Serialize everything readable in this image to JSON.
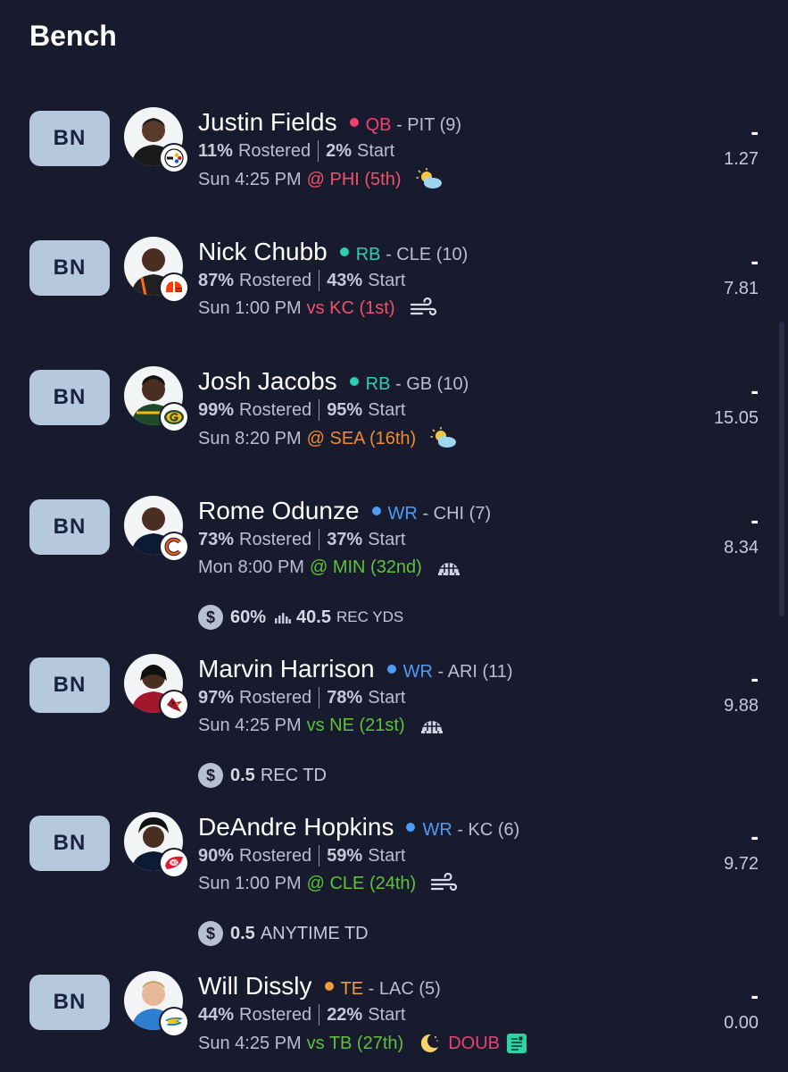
{
  "section_title": "Bench",
  "colors": {
    "qb": "#f0406e",
    "rb": "#2ad0b3",
    "wr": "#4e9bf5",
    "te": "#f39a3a",
    "bad_matchup": "#f0506a",
    "mid_matchup": "#f08a32",
    "good_matchup": "#5dc23a",
    "doub": "#e8446f"
  },
  "players": [
    {
      "slot": "BN",
      "name": "Justin Fields",
      "position": "QB",
      "pos_color": "#f0406e",
      "team": "- PIT (9)",
      "rostered_pct": "11%",
      "rostered_label": "Rostered",
      "start_pct": "2%",
      "start_label": "Start",
      "game_time": "Sun 4:25 PM",
      "opponent": "@ PHI (5th)",
      "opp_color": "#f0506a",
      "weather_icon": "partly-cloudy-icon",
      "team_logo": "steelers-logo",
      "proj_dash": "-",
      "proj_value": "1.27"
    },
    {
      "slot": "BN",
      "name": "Nick Chubb",
      "position": "RB",
      "pos_color": "#2ad0b3",
      "team": "- CLE (10)",
      "rostered_pct": "87%",
      "rostered_label": "Rostered",
      "start_pct": "43%",
      "start_label": "Start",
      "game_time": "Sun 1:00 PM",
      "opponent": "vs KC (1st)",
      "opp_color": "#f0506a",
      "weather_icon": "wind-icon",
      "team_logo": "browns-logo",
      "proj_dash": "-",
      "proj_value": "7.81"
    },
    {
      "slot": "BN",
      "name": "Josh Jacobs",
      "position": "RB",
      "pos_color": "#2ad0b3",
      "team": "- GB (10)",
      "rostered_pct": "99%",
      "rostered_label": "Rostered",
      "start_pct": "95%",
      "start_label": "Start",
      "game_time": "Sun 8:20 PM",
      "opponent": "@ SEA (16th)",
      "opp_color": "#f08a32",
      "weather_icon": "partly-cloudy-icon",
      "team_logo": "packers-logo",
      "proj_dash": "-",
      "proj_value": "15.05"
    },
    {
      "slot": "BN",
      "name": "Rome Odunze",
      "position": "WR",
      "pos_color": "#4e9bf5",
      "team": "- CHI (7)",
      "rostered_pct": "73%",
      "rostered_label": "Rostered",
      "start_pct": "37%",
      "start_label": "Start",
      "game_time": "Mon 8:00 PM",
      "opponent": "@ MIN (32nd)",
      "opp_color": "#5dc23a",
      "weather_icon": "dome-icon",
      "team_logo": "bears-logo",
      "prop": {
        "pct": "60%",
        "value": "40.5",
        "unit": "REC YDS"
      },
      "proj_dash": "-",
      "proj_value": "8.34"
    },
    {
      "slot": "BN",
      "name": "Marvin Harrison",
      "position": "WR",
      "pos_color": "#4e9bf5",
      "team": "- ARI (11)",
      "rostered_pct": "97%",
      "rostered_label": "Rostered",
      "start_pct": "78%",
      "start_label": "Start",
      "game_time": "Sun 4:25 PM",
      "opponent": "vs NE (21st)",
      "opp_color": "#5dc23a",
      "weather_icon": "dome-icon",
      "team_logo": "cardinals-logo",
      "prop": {
        "value": "0.5",
        "unit": "REC TD"
      },
      "proj_dash": "-",
      "proj_value": "9.88"
    },
    {
      "slot": "BN",
      "name": "DeAndre Hopkins",
      "position": "WR",
      "pos_color": "#4e9bf5",
      "team": "- KC (6)",
      "rostered_pct": "90%",
      "rostered_label": "Rostered",
      "start_pct": "59%",
      "start_label": "Start",
      "game_time": "Sun 1:00 PM",
      "opponent": "@ CLE (24th)",
      "opp_color": "#5dc23a",
      "weather_icon": "wind-icon",
      "team_logo": "chiefs-logo",
      "prop": {
        "value": "0.5",
        "unit": "ANYTIME TD"
      },
      "proj_dash": "-",
      "proj_value": "9.72"
    },
    {
      "slot": "BN",
      "name": "Will Dissly",
      "position": "TE",
      "pos_color": "#f39a3a",
      "team": "- LAC (5)",
      "rostered_pct": "44%",
      "rostered_label": "Rostered",
      "start_pct": "22%",
      "start_label": "Start",
      "game_time": "Sun 4:25 PM",
      "opponent": "vs TB (27th)",
      "opp_color": "#5dc23a",
      "weather_icon": "moon-icon",
      "status": "DOUB",
      "team_logo": "chargers-logo",
      "proj_dash": "-",
      "proj_value": "0.00"
    }
  ]
}
